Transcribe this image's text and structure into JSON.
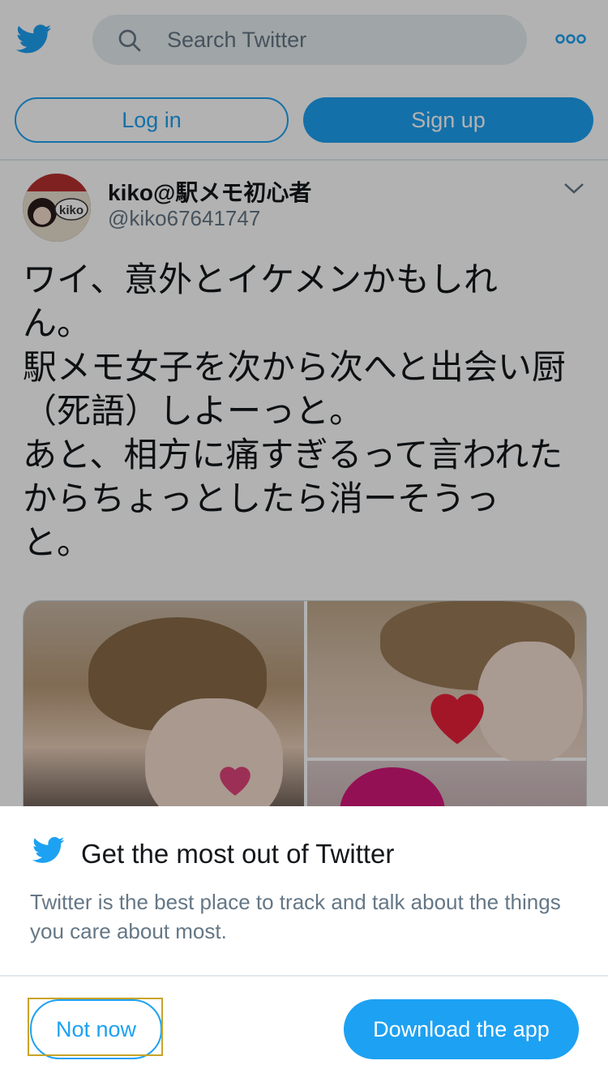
{
  "header": {
    "search_placeholder": "Search Twitter",
    "login_label": "Log in",
    "signup_label": "Sign up",
    "icons": [
      "twitter-bird-icon",
      "search-icon",
      "more-icon"
    ]
  },
  "tweet": {
    "display_name": "kiko@駅メモ初心者",
    "handle": "@kiko67641747",
    "text": "ワイ、意外とイケメンかもしれ\nん。\n駅メモ女子を次から次へと出会い厨\n（死語）しよーっと。\nあと、相方に痛すぎるって言われた\nからちょっとしたら消ーそうっ\nと。",
    "avatar_label": "kiko"
  },
  "prompt": {
    "title": "Get the most out of Twitter",
    "description": "Twitter is the best place to track and talk about the things you care about most.",
    "not_now_label": "Not now",
    "download_label": "Download the app"
  },
  "colors": {
    "brand": "#1da1f2",
    "text_primary": "#14171a",
    "text_secondary": "#657786",
    "focus": "#c8a428"
  }
}
